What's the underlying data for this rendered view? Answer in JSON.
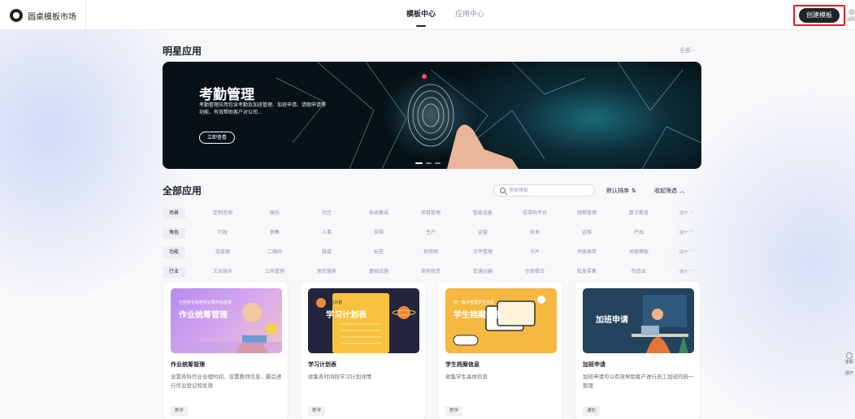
{
  "header": {
    "brand": "圆桌模板市场",
    "tabs": [
      {
        "label": "模板中心",
        "active": true
      },
      {
        "label": "应用中心",
        "active": false
      }
    ],
    "create_button": "创建模板"
  },
  "star_section": {
    "title": "明星应用",
    "see_all": "全部 ›",
    "banner": {
      "title": "考勤管理",
      "description": "考勤管理应用包含考勤及加班管理、加班申请、请假申请等功能，有效帮助客户对公司...",
      "button": "立即查看",
      "slides": 3,
      "active_slide": 1
    }
  },
  "all_apps": {
    "title": "全部应用",
    "search_placeholder": "搜索模板",
    "sort_label": "默认排序",
    "sort_icon": "sort-icon",
    "collapse_label": "收起筛选",
    "filters": [
      {
        "category": "场景",
        "options": [
          "定制咨询",
          "娱乐",
          "社区",
          "系统集成",
          "项目管理",
          "智能设备",
          "低零码平台",
          "财税管理",
          "数字教育"
        ],
        "expand": "展开 ﹀"
      },
      {
        "category": "角色",
        "options": [
          "行政",
          "销售",
          "人事",
          "采购",
          "生产",
          "运营",
          "研发",
          "运维",
          "产品"
        ],
        "expand": "展开 ﹀"
      },
      {
        "category": "功能",
        "options": [
          "连接器",
          "二维码",
          "链接",
          "标签",
          "地铁图",
          "文件管理",
          "卡片",
          "关联表单",
          "关联模板"
        ],
        "expand": "展开 ﹀"
      },
      {
        "category": "行业",
        "options": [
          "文化娱乐",
          "公共管理",
          "居民服务",
          "基础设施",
          "商务租赁",
          "交通运输",
          "住宿餐饮",
          "批发零售",
          "制造业"
        ],
        "expand": "展开 ﹀"
      }
    ],
    "cards": [
      {
        "name": "作业统筹管理",
        "description": "设置各科作业合理时间、设置教师信息、最后进行作业登记和反馈",
        "tag": "教学",
        "thumb_caption": "方便家长和老师记录作业信息",
        "thumb_title": "作业统筹管理"
      },
      {
        "name": "学习计划表",
        "description": "收集各时间段学习计划详情",
        "tag": "教学",
        "thumb_caption": "学习计划",
        "thumb_title": "学习计划表"
      },
      {
        "name": "学生档案信息",
        "description": "收集学生具体信息",
        "tag": "教学",
        "thumb_caption": "统一集中管理学生信息",
        "thumb_title": "学生档案信息"
      },
      {
        "name": "加班申请",
        "description": "加班申请可以有效帮助客户进行员工加班的统一管理",
        "tag": "通知",
        "thumb_caption": "",
        "thumb_title": "加班申请"
      }
    ]
  },
  "side_float": [
    {
      "label": "客服",
      "icon": "chat-icon"
    },
    {
      "label": "展开",
      "icon": "expand-icon"
    }
  ]
}
